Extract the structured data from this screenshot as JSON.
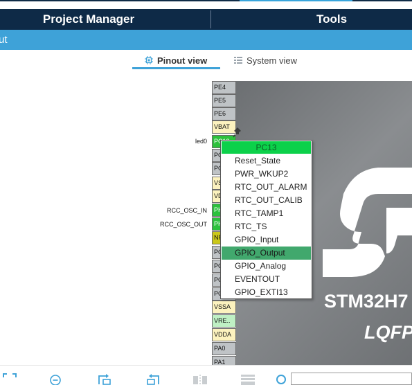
{
  "header": {
    "tabs": [
      {
        "label": "Project Manager"
      },
      {
        "label": "Tools"
      }
    ]
  },
  "subbar": {
    "label": "ut"
  },
  "views": {
    "pinout": "Pinout view",
    "system": "System view",
    "active": "pinout"
  },
  "pins": [
    {
      "label": "PE4",
      "style": "gray"
    },
    {
      "label": "PE5",
      "style": "gray"
    },
    {
      "label": "PE6",
      "style": "gray"
    },
    {
      "label": "VBAT",
      "style": "yellow"
    },
    {
      "label": "PC13",
      "style": "green"
    },
    {
      "label": "PC14",
      "style": "gray"
    },
    {
      "label": "PC15",
      "style": "gray"
    },
    {
      "label": "VSS",
      "style": "yellow"
    },
    {
      "label": "VDD",
      "style": "yellow"
    },
    {
      "label": "PH0",
      "style": "green"
    },
    {
      "label": "PH1",
      "style": "green"
    },
    {
      "label": "NRST",
      "style": "olive"
    },
    {
      "label": "PC0",
      "style": "gray"
    },
    {
      "label": "PC1",
      "style": "gray"
    },
    {
      "label": "PC2",
      "style": "gray"
    },
    {
      "label": "PC3",
      "style": "gray"
    },
    {
      "label": "VSSA",
      "style": "yellow"
    },
    {
      "label": "VRE..",
      "style": "lightgreen"
    },
    {
      "label": "VDDA",
      "style": "yellow"
    },
    {
      "label": "PA0",
      "style": "gray"
    },
    {
      "label": "PA1",
      "style": "gray"
    }
  ],
  "signal_labels": [
    {
      "text": "led0"
    },
    {
      "text": "RCC_OSC_IN"
    },
    {
      "text": "RCC_OSC_OUT"
    }
  ],
  "chip": {
    "name": "STM32H7",
    "package": "LQFP"
  },
  "context_menu": {
    "title": "PC13",
    "items": [
      "Reset_State",
      "PWR_WKUP2",
      "RTC_OUT_ALARM",
      "RTC_OUT_CALIB",
      "RTC_TAMP1",
      "RTC_TS",
      "GPIO_Input",
      "GPIO_Output",
      "GPIO_Analog",
      "EVENTOUT",
      "GPIO_EXTI13"
    ],
    "selected": "GPIO_Output"
  },
  "toolbar": {
    "icons": [
      "fit-screen-icon",
      "zoom-out-icon",
      "rotate-right-icon",
      "rotate-left-icon",
      "flip-icon",
      "grid-icon",
      "search-icon"
    ],
    "search_value": ""
  },
  "colors": {
    "header_bg": "#0e2a47",
    "subbar_bg": "#3ea2d8",
    "pin_green": "#2cc13c",
    "menu_title": "#0cd14a",
    "menu_selected": "#41a86d"
  }
}
